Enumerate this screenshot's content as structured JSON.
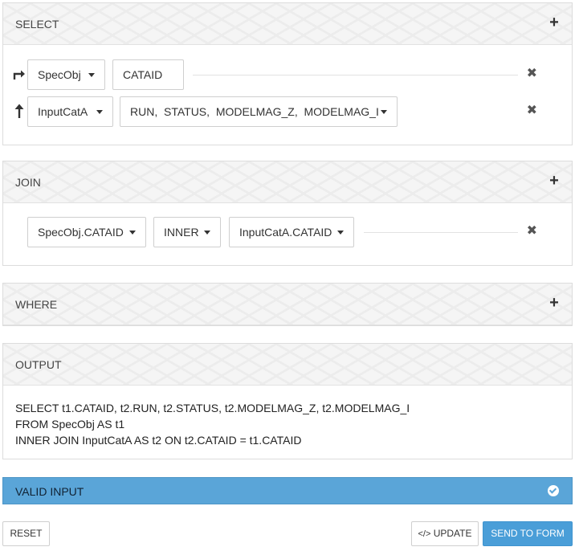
{
  "select": {
    "title": "SELECT",
    "add_icon": "plus-icon",
    "rows": [
      {
        "icon": "arrow-turn-right-icon",
        "table": "SpecObj",
        "columns": "CATAID"
      },
      {
        "icon": "arrow-up-icon",
        "table": "InputCatA",
        "columns": "RUN,  STATUS,  MODELMAG_Z,  MODELMAG_I"
      }
    ]
  },
  "join": {
    "title": "JOIN",
    "left": "SpecObj.CATAID",
    "type": "INNER",
    "right": "InputCatA.CATAID"
  },
  "where": {
    "title": "WHERE"
  },
  "output": {
    "title": "OUTPUT",
    "line1": "SELECT t1.CATAID, t2.RUN, t2.STATUS, t2.MODELMAG_Z, t2.MODELMAG_I",
    "line2": "FROM SpecObj AS t1",
    "line3": "INNER JOIN InputCatA AS t2 ON t2.CATAID = t1.CATAID"
  },
  "status": {
    "text": "VALID INPUT",
    "icon": "check-circle-icon",
    "color": "#5aa5d8"
  },
  "buttons": {
    "reset": "RESET",
    "update": "UPDATE",
    "send": "SEND TO FORM"
  }
}
